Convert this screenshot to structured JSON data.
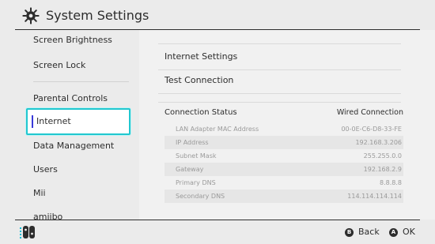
{
  "header": {
    "title": "System Settings",
    "icon": "gear-icon"
  },
  "sidebar": {
    "items": [
      {
        "label": "Screen Brightness"
      },
      {
        "label": "Screen Lock"
      },
      {
        "label": "Parental Controls"
      },
      {
        "label": "Internet",
        "selected": true
      },
      {
        "label": "Data Management"
      },
      {
        "label": "Users"
      },
      {
        "label": "Mii"
      },
      {
        "label": "amiibo"
      }
    ]
  },
  "main": {
    "items": [
      {
        "label": "Internet Settings"
      },
      {
        "label": "Test Connection"
      }
    ],
    "connection_status": {
      "label": "Connection Status",
      "value": "Wired Connection",
      "rows": [
        {
          "label": "LAN Adapter MAC Address",
          "value": "00-0E-C6-D8-33-FE"
        },
        {
          "label": "IP Address",
          "value": "192.168.3.206"
        },
        {
          "label": "Subnet Mask",
          "value": "255.255.0.0"
        },
        {
          "label": "Gateway",
          "value": "192.168.2.9"
        },
        {
          "label": "Primary DNS",
          "value": "8.8.8.8"
        },
        {
          "label": "Secondary DNS",
          "value": "114.114.114.114"
        }
      ]
    }
  },
  "footer": {
    "controller_icon": "joycon-icon",
    "back": {
      "glyph": "B",
      "label": "Back"
    },
    "ok": {
      "glyph": "A",
      "label": "OK"
    }
  },
  "colors": {
    "selection_border": "#21c7cf",
    "selection_bar": "#3a3ad9",
    "joycon_left": "#00bcd4",
    "joycon_right": "#ff3b30"
  }
}
